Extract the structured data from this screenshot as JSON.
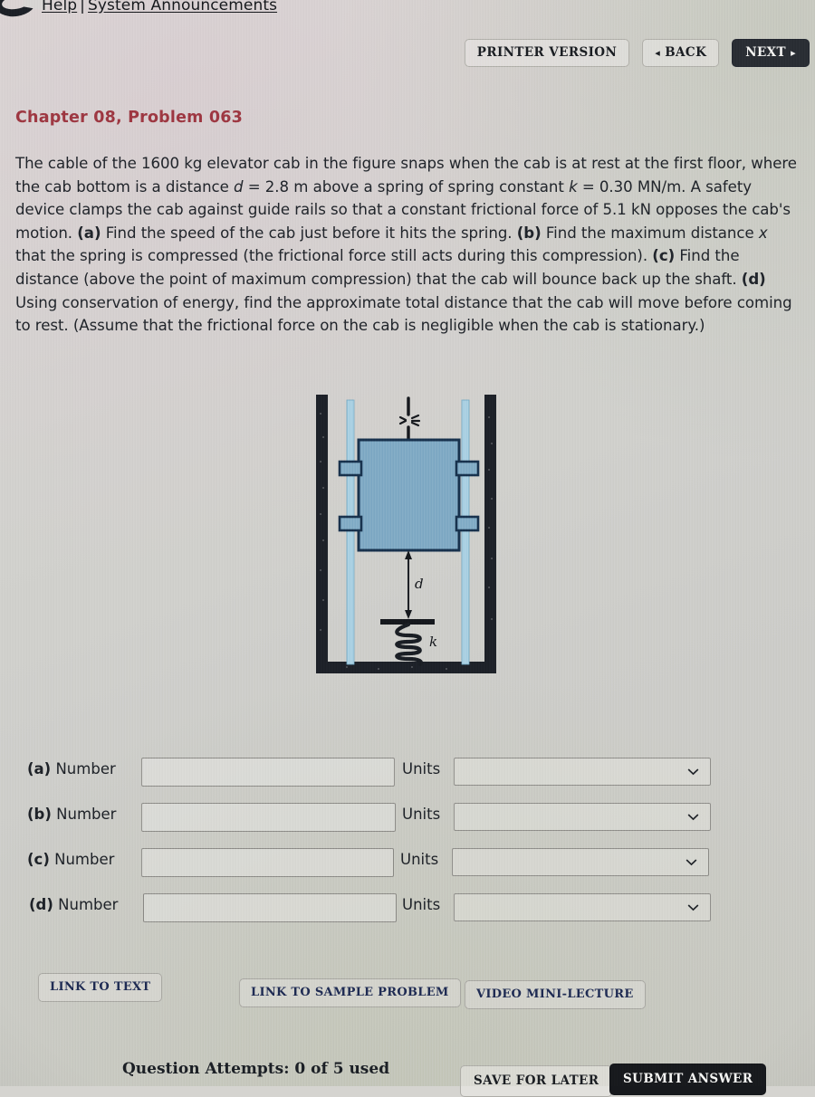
{
  "header": {
    "logo_icon": "wileyplus-logo-icon",
    "help_label": "Help",
    "separator": "|",
    "announcements_label": "System Announcements",
    "buttons": {
      "printer_version": "PRINTER VERSION",
      "back": "BACK",
      "back_arrow": "◂",
      "next": "NEXT",
      "next_arrow": "▸"
    }
  },
  "content": {
    "chapter_title": "Chapter 08, Problem 063",
    "problem_text_parts": [
      "The cable of the 1600 kg elevator cab in the figure snaps when the cab is at rest at the first floor, where the cab bottom is a distance ",
      "d",
      " = 2.8 m above a spring of spring constant ",
      "k",
      " = 0.30 MN/m. A safety device clamps the cab against guide rails so that a constant frictional force of 5.1 kN opposes the cab's motion. ",
      "(a)",
      " Find the speed of the cab just before it hits the spring. ",
      "(b)",
      " Find the maximum distance ",
      "x",
      " that the spring is compressed (the frictional force still acts during this compression). ",
      "(c)",
      " Find the distance (above the point of maximum compression) that the cab will bounce back up the shaft. ",
      "(d)",
      " Using conservation of energy, find the approximate total distance that the cab will move before coming to rest. (Assume that the frictional force on the cab is negligible when the cab is stationary.)"
    ],
    "given": {
      "mass": "1600 kg",
      "distance_d": "2.8 m",
      "spring_constant_k": "0.30 MN/m",
      "friction_force": "5.1 kN"
    }
  },
  "figure": {
    "name": "elevator-shaft-diagram",
    "labels": {
      "distance": "d",
      "spring": "k"
    },
    "colors": {
      "cab_fill": "#7fa9c4",
      "cab_stroke": "#1d3550",
      "rail": "#a8cfe0",
      "shaft": "#1d2128"
    },
    "parts": [
      "shaft-walls",
      "guide-rails",
      "elevator-cab",
      "guide-clamps",
      "snapped-cable",
      "distance-arrow",
      "spring"
    ]
  },
  "answers": {
    "number_label": "Number",
    "units_label": "Units",
    "rows": [
      {
        "tag": "(a)",
        "value": "",
        "units": ""
      },
      {
        "tag": "(b)",
        "value": "",
        "units": ""
      },
      {
        "tag": "(c)",
        "value": "",
        "units": ""
      },
      {
        "tag": "(d)",
        "value": "",
        "units": ""
      }
    ]
  },
  "links": {
    "link_to_text": "LINK TO TEXT",
    "link_to_sample_problem": "LINK TO SAMPLE PROBLEM",
    "video_mini_lecture": "VIDEO MINI-LECTURE"
  },
  "footer": {
    "attempts": "Question Attempts: 0 of 5 used",
    "save_for_later": "SAVE FOR LATER",
    "submit_answer": "SUBMIT ANSWER"
  },
  "colors": {
    "heading": "#9d3741",
    "link_text": "#1e2a52",
    "dark_button": "#17191d",
    "page_background": "#d2d2ce"
  }
}
